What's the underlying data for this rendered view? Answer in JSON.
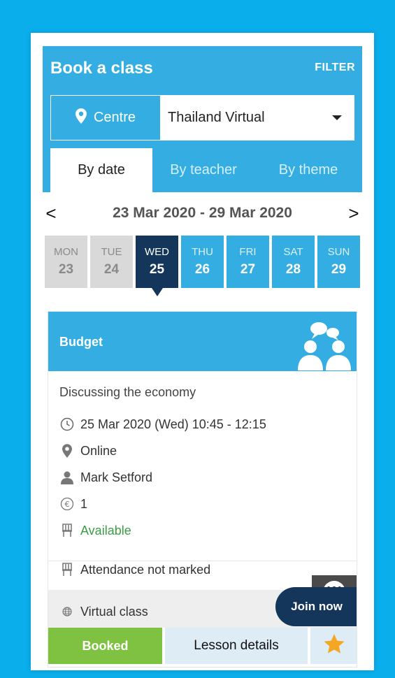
{
  "header": {
    "title": "Book a class",
    "filter_label": "FILTER"
  },
  "centre": {
    "label": "Centre",
    "selected": "Thailand Virtual"
  },
  "tabs": [
    {
      "label": "By date",
      "active": true
    },
    {
      "label": "By teacher",
      "active": false
    },
    {
      "label": "By theme",
      "active": false
    }
  ],
  "week": {
    "range": "23 Mar 2020 - 29 Mar 2020",
    "prev": "<",
    "next": ">"
  },
  "days": [
    {
      "name": "MON",
      "date": "23",
      "state": "past"
    },
    {
      "name": "TUE",
      "date": "24",
      "state": "past"
    },
    {
      "name": "WED",
      "date": "25",
      "state": "selected"
    },
    {
      "name": "THU",
      "date": "26",
      "state": "future"
    },
    {
      "name": "FRI",
      "date": "27",
      "state": "future"
    },
    {
      "name": "SAT",
      "date": "28",
      "state": "future"
    },
    {
      "name": "SUN",
      "date": "29",
      "state": "future"
    }
  ],
  "class_card": {
    "title": "Budget",
    "topic": "Discussing the economy",
    "datetime": "25 Mar 2020 (Wed) 10:45 - 12:15",
    "location": "Online",
    "teacher": "Mark Setford",
    "credits": "1",
    "availability": "Available",
    "attendance": "Attendance not marked",
    "w_badge": "W",
    "virtual_label": "Virtual class",
    "join_label": "Join now",
    "booked_label": "Booked",
    "details_label": "Lesson details"
  },
  "icons": {
    "centre": "map-pin-icon",
    "datetime": "clock-icon",
    "location": "map-pin-icon",
    "teacher": "person-icon",
    "credits": "credit-icon",
    "availability": "chair-icon",
    "attendance": "chair-icon",
    "virtual": "globe-icon",
    "favourite": "star-icon",
    "header": "conversation-icon"
  },
  "colors": {
    "background": "#0aaeea",
    "primary_blue": "#34ade2",
    "navy": "#14365b",
    "green": "#7fc241",
    "available_green": "#3a9e45",
    "star": "#f5a623"
  }
}
